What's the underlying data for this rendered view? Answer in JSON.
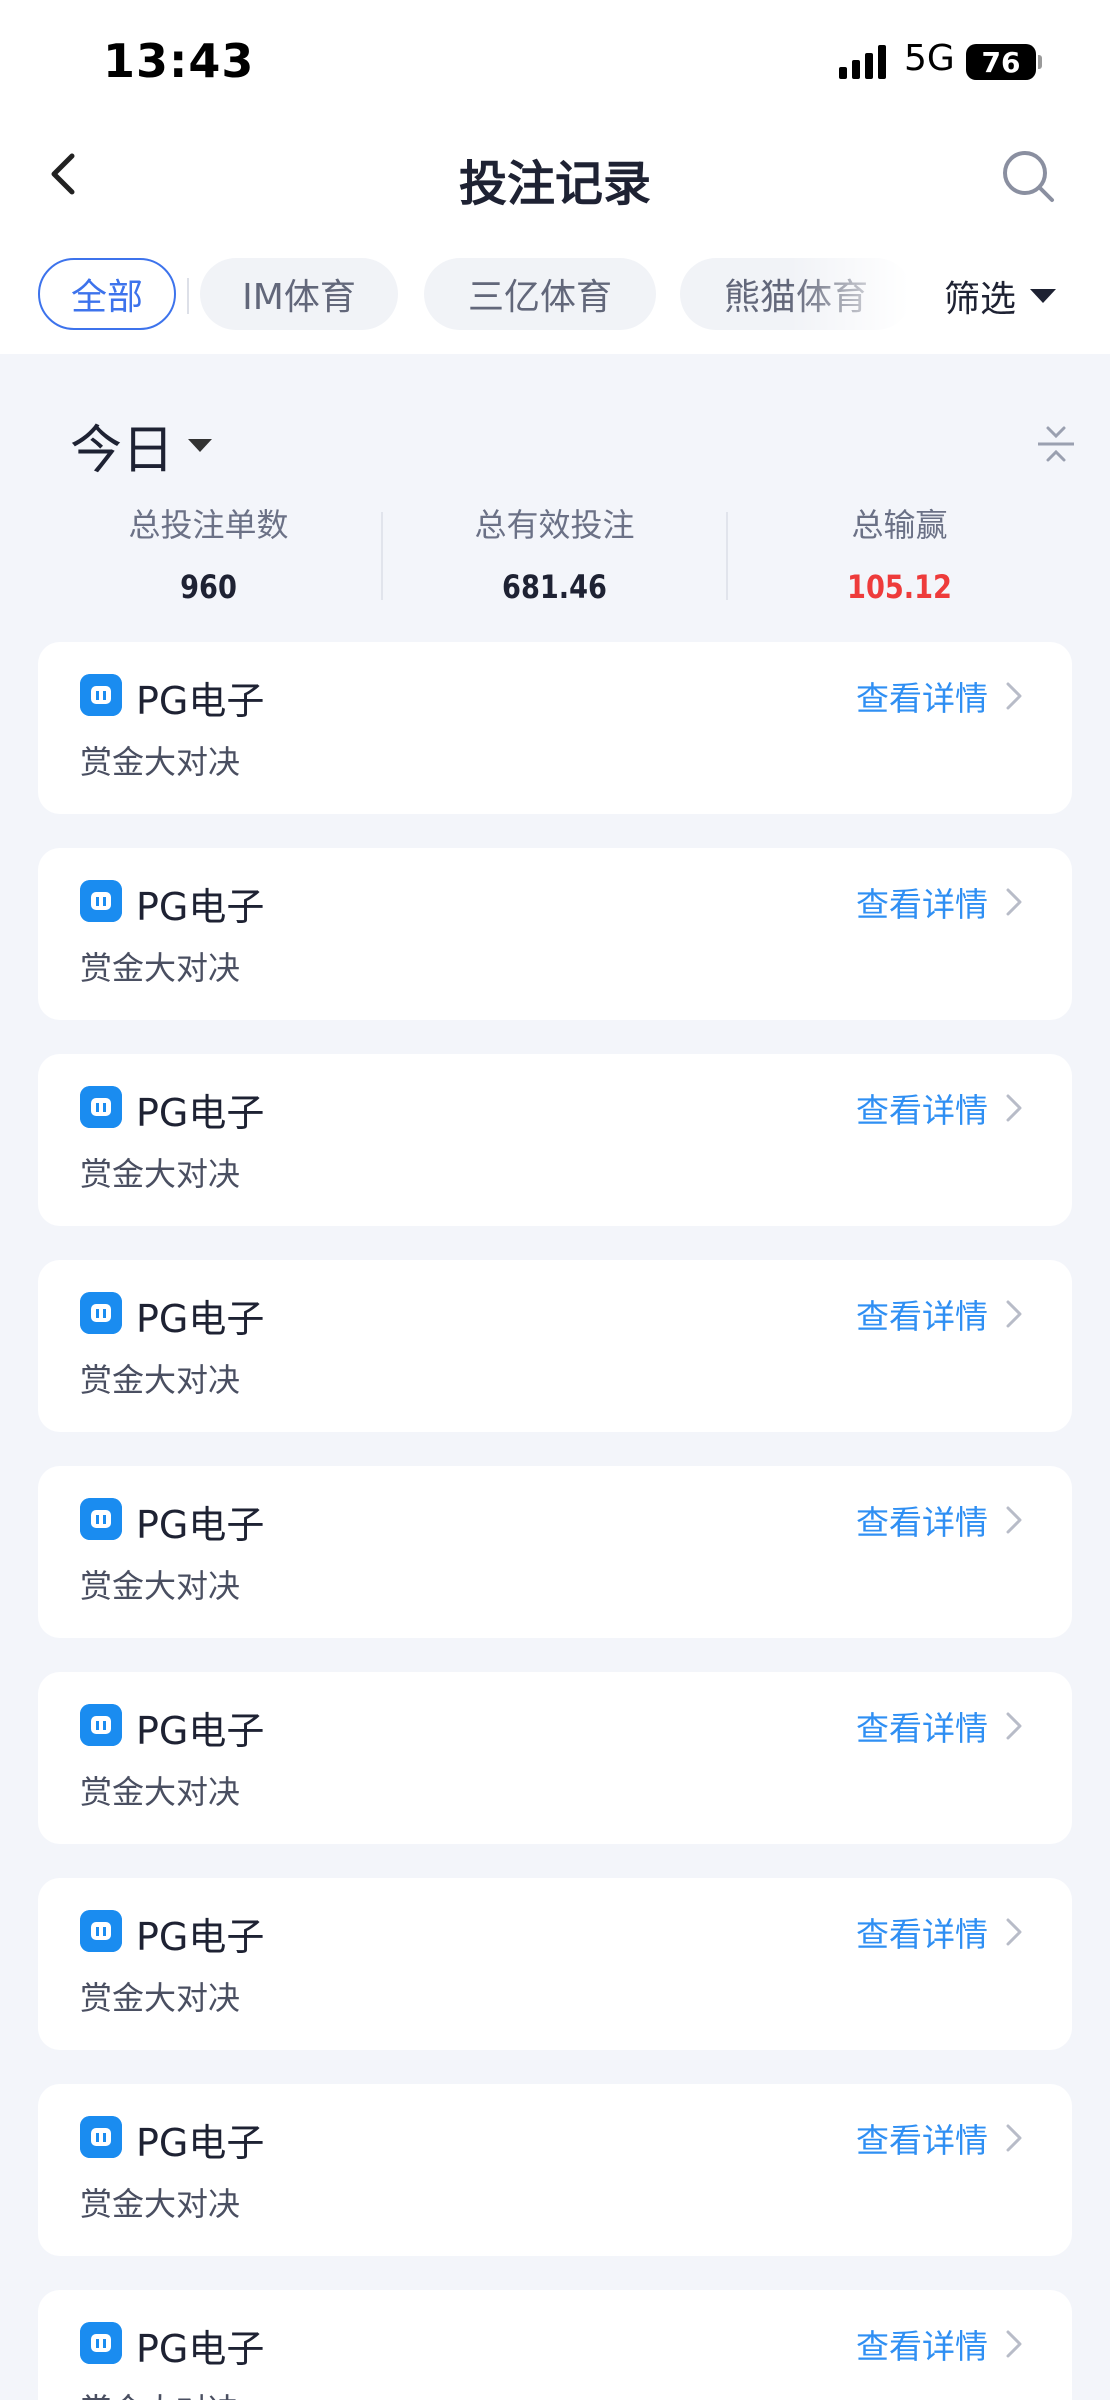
{
  "status_bar": {
    "time": "13:43",
    "network": "5G",
    "battery": "76"
  },
  "header": {
    "title": "投注记录"
  },
  "tabs": [
    {
      "label": "全部",
      "active": true
    },
    {
      "label": "IM体育",
      "active": false
    },
    {
      "label": "三亿体育",
      "active": false
    },
    {
      "label": "熊猫体育",
      "active": false
    }
  ],
  "filter": {
    "label": "筛选"
  },
  "summary": {
    "period": "今日",
    "stats": [
      {
        "label": "总投注单数",
        "value": "960"
      },
      {
        "label": "总有效投注",
        "value": "681.46"
      },
      {
        "label": "总输赢",
        "value": "105.12"
      }
    ]
  },
  "records": [
    {
      "provider": "PG电子",
      "game": "赏金大对决",
      "detail_label": "查看详情"
    },
    {
      "provider": "PG电子",
      "game": "赏金大对决",
      "detail_label": "查看详情"
    },
    {
      "provider": "PG电子",
      "game": "赏金大对决",
      "detail_label": "查看详情"
    },
    {
      "provider": "PG电子",
      "game": "赏金大对决",
      "detail_label": "查看详情"
    },
    {
      "provider": "PG电子",
      "game": "赏金大对决",
      "detail_label": "查看详情"
    },
    {
      "provider": "PG电子",
      "game": "赏金大对决",
      "detail_label": "查看详情"
    },
    {
      "provider": "PG电子",
      "game": "赏金大对决",
      "detail_label": "查看详情"
    },
    {
      "provider": "PG电子",
      "game": "赏金大对决",
      "detail_label": "查看详情"
    },
    {
      "provider": "PG电子",
      "game": "赏金大对决",
      "detail_label": "查看详情"
    }
  ],
  "colors": {
    "accent": "#3d73ec",
    "link": "#2f8ff3",
    "loss": "#ee3b3b",
    "background": "#f3f5fa"
  }
}
